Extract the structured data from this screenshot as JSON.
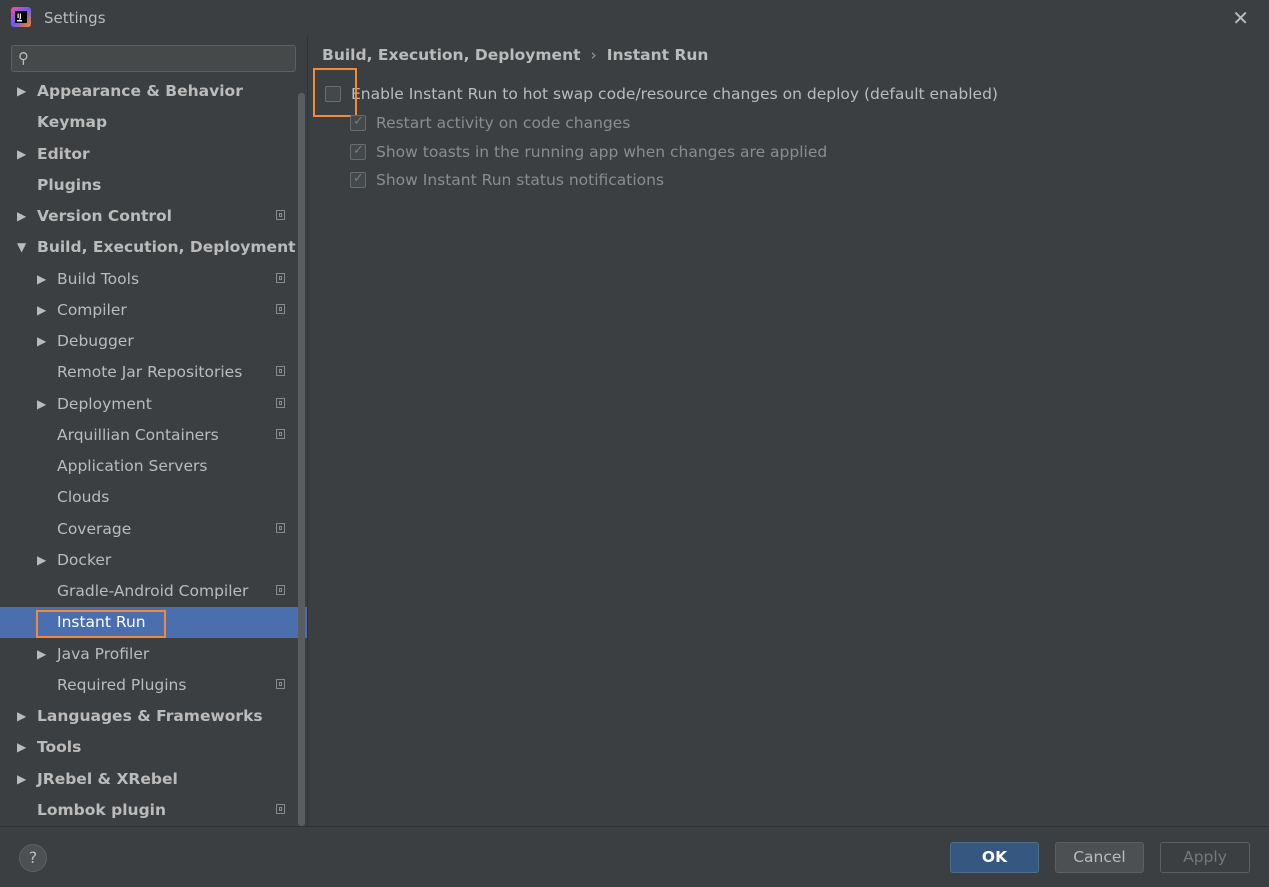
{
  "window": {
    "title": "Settings",
    "close_glyph": "✕"
  },
  "colors": {
    "accent_selected": "#4b6eaf",
    "highlight_box": "#f08a3c",
    "ok_button": "#365880"
  },
  "search": {
    "placeholder": "",
    "icon": "search-icon"
  },
  "sidebar": {
    "items": [
      {
        "label": "Appearance & Behavior",
        "arrow": "▶",
        "bold": true
      },
      {
        "label": "Keymap",
        "arrow": "",
        "bold": true
      },
      {
        "label": "Editor",
        "arrow": "▶",
        "bold": true
      },
      {
        "label": "Plugins",
        "arrow": "",
        "bold": true
      },
      {
        "label": "Version Control",
        "arrow": "▶",
        "bold": true
      },
      {
        "label": "Build, Execution, Deployment",
        "arrow": "▼",
        "bold": true
      },
      {
        "label": "Build Tools",
        "arrow": "▶"
      },
      {
        "label": "Compiler",
        "arrow": "▶"
      },
      {
        "label": "Debugger",
        "arrow": "▶"
      },
      {
        "label": "Remote Jar Repositories",
        "arrow": ""
      },
      {
        "label": "Deployment",
        "arrow": "▶"
      },
      {
        "label": "Arquillian Containers",
        "arrow": ""
      },
      {
        "label": "Application Servers",
        "arrow": ""
      },
      {
        "label": "Clouds",
        "arrow": ""
      },
      {
        "label": "Coverage",
        "arrow": ""
      },
      {
        "label": "Docker",
        "arrow": "▶"
      },
      {
        "label": "Gradle-Android Compiler",
        "arrow": ""
      },
      {
        "label": "Instant Run",
        "arrow": ""
      },
      {
        "label": "Java Profiler",
        "arrow": "▶"
      },
      {
        "label": "Required Plugins",
        "arrow": ""
      },
      {
        "label": "Languages & Frameworks",
        "arrow": "▶",
        "bold": true
      },
      {
        "label": "Tools",
        "arrow": "▶",
        "bold": true
      },
      {
        "label": "JRebel & XRebel",
        "arrow": "▶",
        "bold": true
      },
      {
        "label": "Lombok plugin",
        "arrow": "",
        "bold": true
      }
    ]
  },
  "breadcrumb": {
    "parent": "Build, Execution, Deployment",
    "separator": "›",
    "current": "Instant Run"
  },
  "options": {
    "enable": {
      "label": "Enable Instant Run to hot swap code/resource changes on deploy (default enabled)",
      "checked": false
    },
    "restart": {
      "label": "Restart activity on code changes",
      "checked": true
    },
    "toasts": {
      "label": "Show toasts in the running app when changes are applied",
      "checked": true
    },
    "notifications": {
      "label": "Show Instant Run status notifications",
      "checked": true
    }
  },
  "footer": {
    "help": "?",
    "ok": "OK",
    "cancel": "Cancel",
    "apply": "Apply"
  }
}
